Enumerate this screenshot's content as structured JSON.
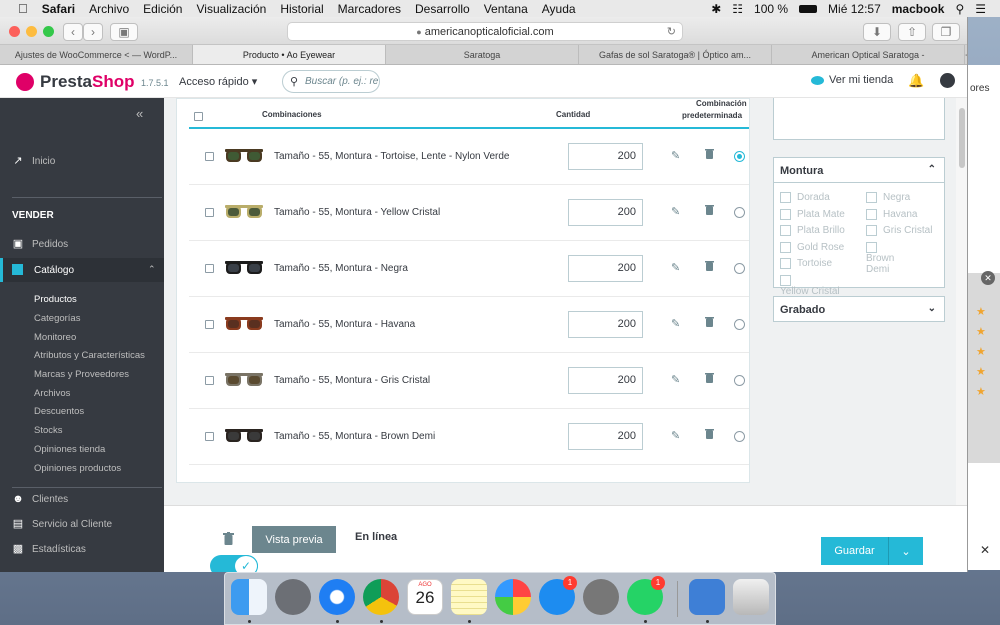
{
  "menubar": {
    "app": "Safari",
    "items": [
      "Archivo",
      "Edición",
      "Visualización",
      "Historial",
      "Marcadores",
      "Desarrollo",
      "Ventana",
      "Ayuda"
    ],
    "battery": "100 %",
    "clock": "Mié 12:57",
    "user": "macbook"
  },
  "browser": {
    "url": "americanopticaloficial.com",
    "tabs": [
      "Ajustes de WooCommerce < — WordP...",
      "Producto • Ao Eyewear",
      "Saratoga",
      "Gafas de sol Saratoga® | Óptico am...",
      "American Optical Saratoga -"
    ],
    "active_tab": 1
  },
  "header": {
    "logo_prefix": "Presta",
    "logo_suffix": "Shop",
    "version": "1.7.5.1",
    "quick_access": "Acceso rápido",
    "search_placeholder": "Buscar (p. ej.: re",
    "view_shop": "Ver mi tienda"
  },
  "sidebar": {
    "inicio": "Inicio",
    "section_vender": "VENDER",
    "pedidos": "Pedidos",
    "catalogo": "Catálogo",
    "catalog_items": [
      "Productos",
      "Categorías",
      "Monitoreo",
      "Atributos y Características",
      "Marcas y Proveedores",
      "Archivos",
      "Descuentos",
      "Stocks",
      "Opiniones tienda",
      "Opiniones productos"
    ],
    "clientes": "Clientes",
    "servicio": "Servicio al Cliente",
    "estadisticas": "Estadísticas"
  },
  "table": {
    "col_combinations": "Combinaciones",
    "col_quantity": "Cantidad",
    "col_default_1": "Combinación",
    "col_default_2": "predeterminada",
    "rows": [
      {
        "label": "Tamaño - 55, Montura - Tortoise, Lente - Nylon Verde",
        "qty": "200",
        "default": true,
        "frame": "#4a3a22",
        "lens": "#3f5a34"
      },
      {
        "label": "Tamaño - 55, Montura - Yellow Cristal",
        "qty": "200",
        "default": false,
        "frame": "#b9ad6a",
        "lens": "#4b5a3a"
      },
      {
        "label": "Tamaño - 55, Montura - Negra",
        "qty": "200",
        "default": false,
        "frame": "#1c1c1c",
        "lens": "#3a4048"
      },
      {
        "label": "Tamaño - 55, Montura - Havana",
        "qty": "200",
        "default": false,
        "frame": "#8a3b1e",
        "lens": "#5a3020"
      },
      {
        "label": "Tamaño - 55, Montura - Gris Cristal",
        "qty": "200",
        "default": false,
        "frame": "#7a7466",
        "lens": "#5a4a30"
      },
      {
        "label": "Tamaño - 55, Montura - Brown Demi",
        "qty": "200",
        "default": false,
        "frame": "#2a2420",
        "lens": "#3a3a3a"
      }
    ]
  },
  "filters": {
    "montura_title": "Montura",
    "montura_options_left": [
      "Dorada",
      "Plata Mate",
      "Plata Brillo",
      "Gold Rose",
      "Tortoise",
      "Yellow Cristal"
    ],
    "montura_options_right": [
      "Negra",
      "Havana",
      "Gris Cristal",
      "Brown Demi"
    ],
    "grabado_title": "Grabado"
  },
  "footer": {
    "preview": "Vista previa",
    "online": "En línea",
    "save": "Guardar"
  },
  "background_window": {
    "text": "ores"
  },
  "dock": {
    "calendar_month": "AGO",
    "calendar_day": "26",
    "badge_appstore": "1",
    "badge_whatsapp": "1"
  },
  "colors": {
    "accent": "#25b9d7",
    "brand": "#df0067",
    "sidebar": "#363a41"
  }
}
